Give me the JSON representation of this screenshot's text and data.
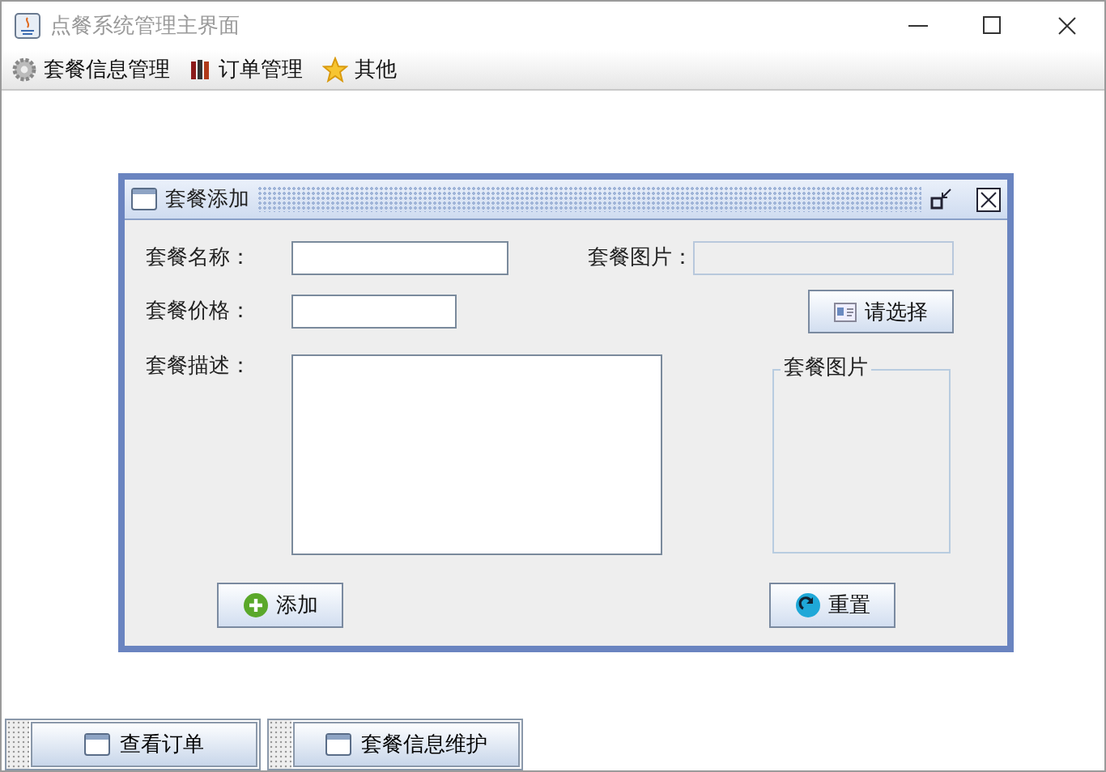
{
  "window": {
    "title": "点餐系统管理主界面"
  },
  "menu": [
    {
      "label": "套餐信息管理"
    },
    {
      "label": "订单管理"
    },
    {
      "label": "其他"
    }
  ],
  "dialog": {
    "title": "套餐添加",
    "name_label": "套餐名称：",
    "price_label": "套餐价格：",
    "description_label": "套餐描述：",
    "image_label": "套餐图片：",
    "image_field": {
      "disabled": true
    },
    "choose_button": "请选择",
    "preview_title": "套餐图片",
    "add_button": "添加",
    "reset_button": "重置"
  },
  "taskbar": [
    {
      "label": "查看订单"
    },
    {
      "label": "套餐信息维护"
    }
  ]
}
